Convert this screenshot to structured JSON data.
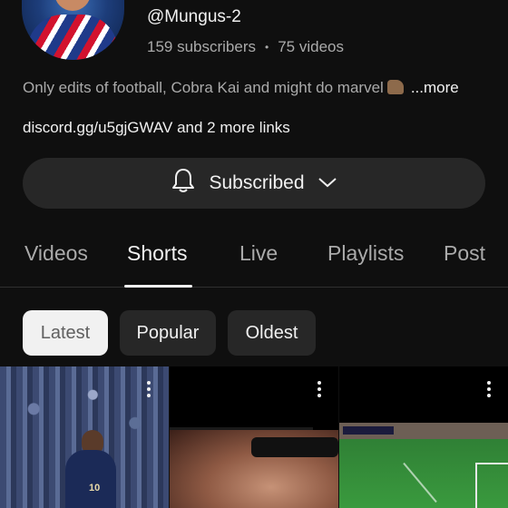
{
  "channel": {
    "handle": "@Mungus-2",
    "subscribers": "159 subscribers",
    "separator": "•",
    "videos": "75 videos",
    "description": "Only edits of football, Cobra Kai and might do marvel",
    "more_label": "...more",
    "links": "discord.gg/u5gjGWAV and 2 more links"
  },
  "subscribe_button": {
    "label": "Subscribed",
    "icons": [
      "bell-icon",
      "chevron-down-icon"
    ]
  },
  "tabs": [
    {
      "label": "Videos",
      "active": false
    },
    {
      "label": "Shorts",
      "active": true
    },
    {
      "label": "Live",
      "active": false
    },
    {
      "label": "Playlists",
      "active": false
    },
    {
      "label": "Post",
      "active": false
    }
  ],
  "filters": [
    {
      "label": "Latest",
      "active": true
    },
    {
      "label": "Popular",
      "active": false
    },
    {
      "label": "Oldest",
      "active": false
    }
  ],
  "thumbnails": [
    {
      "jersey_number": "10"
    },
    {},
    {}
  ],
  "colors": {
    "background": "#0f0f0f",
    "chip_bg": "#272727",
    "active_chip_bg": "#f1f1f1",
    "secondary_text": "#aaaaaa"
  }
}
